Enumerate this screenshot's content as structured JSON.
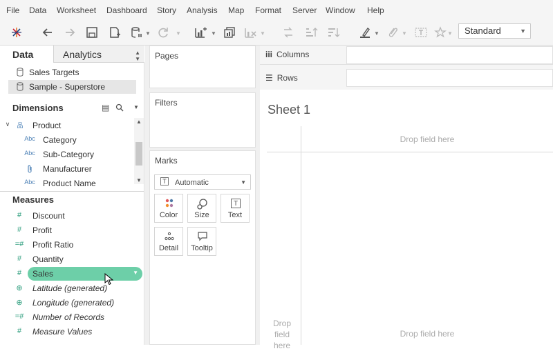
{
  "menu": [
    "File",
    "Data",
    "Worksheet",
    "Dashboard",
    "Story",
    "Analysis",
    "Map",
    "Format",
    "Server",
    "Window",
    "Help"
  ],
  "toolbar": {
    "icons": [
      "tableau-logo-icon",
      "undo-icon",
      "redo-icon",
      "save-icon",
      "new-data-source-icon",
      "pause-updates-icon",
      "refresh-icon",
      "new-worksheet-icon",
      "duplicate-sheet-icon",
      "clear-sheet-icon",
      "swap-icon",
      "sort-asc-icon",
      "sort-desc-icon",
      "highlight-icon",
      "group-icon",
      "label-icon",
      "pin-icon"
    ],
    "fit_value": "Standard"
  },
  "data_pane": {
    "tab_data": "Data",
    "tab_analytics": "Analytics",
    "data_sources": [
      "Sales Targets",
      "Sample - Superstore"
    ],
    "dimensions_header": "Dimensions",
    "dimension_group": "Product",
    "dimensions": [
      {
        "type": "Abc",
        "label": "Category"
      },
      {
        "type": "Abc",
        "label": "Sub-Category"
      },
      {
        "type": "clip",
        "label": "Manufacturer"
      },
      {
        "type": "Abc",
        "label": "Product Name"
      }
    ],
    "measures_header": "Measures",
    "measures": [
      {
        "label": "Discount",
        "italic": false
      },
      {
        "label": "Profit",
        "italic": false
      },
      {
        "label": "Profit Ratio",
        "italic": false
      },
      {
        "label": "Quantity",
        "italic": false
      },
      {
        "label": "Sales",
        "italic": false
      },
      {
        "label": "Latitude (generated)",
        "italic": true
      },
      {
        "label": "Longitude (generated)",
        "italic": true
      },
      {
        "label": "Number of Records",
        "italic": true
      },
      {
        "label": "Measure Values",
        "italic": true
      }
    ]
  },
  "shelves": {
    "pages": "Pages",
    "filters": "Filters",
    "marks": "Marks",
    "mark_type": "Automatic",
    "mark_buttons": [
      "Color",
      "Size",
      "Text",
      "Detail",
      "Tooltip"
    ],
    "columns": "Columns",
    "rows": "Rows"
  },
  "view": {
    "sheet_title": "Sheet 1",
    "drop_field_top": "Drop field here",
    "drop_field_bottom": "Drop field here",
    "drop_field_left_1": "Drop",
    "drop_field_left_2": "field",
    "drop_field_left_3": "here"
  },
  "colors": {
    "accent_pill": "#6dcfa8",
    "measure_icon": "#2e9e7e",
    "dimension_icon": "#4a7fb5"
  }
}
